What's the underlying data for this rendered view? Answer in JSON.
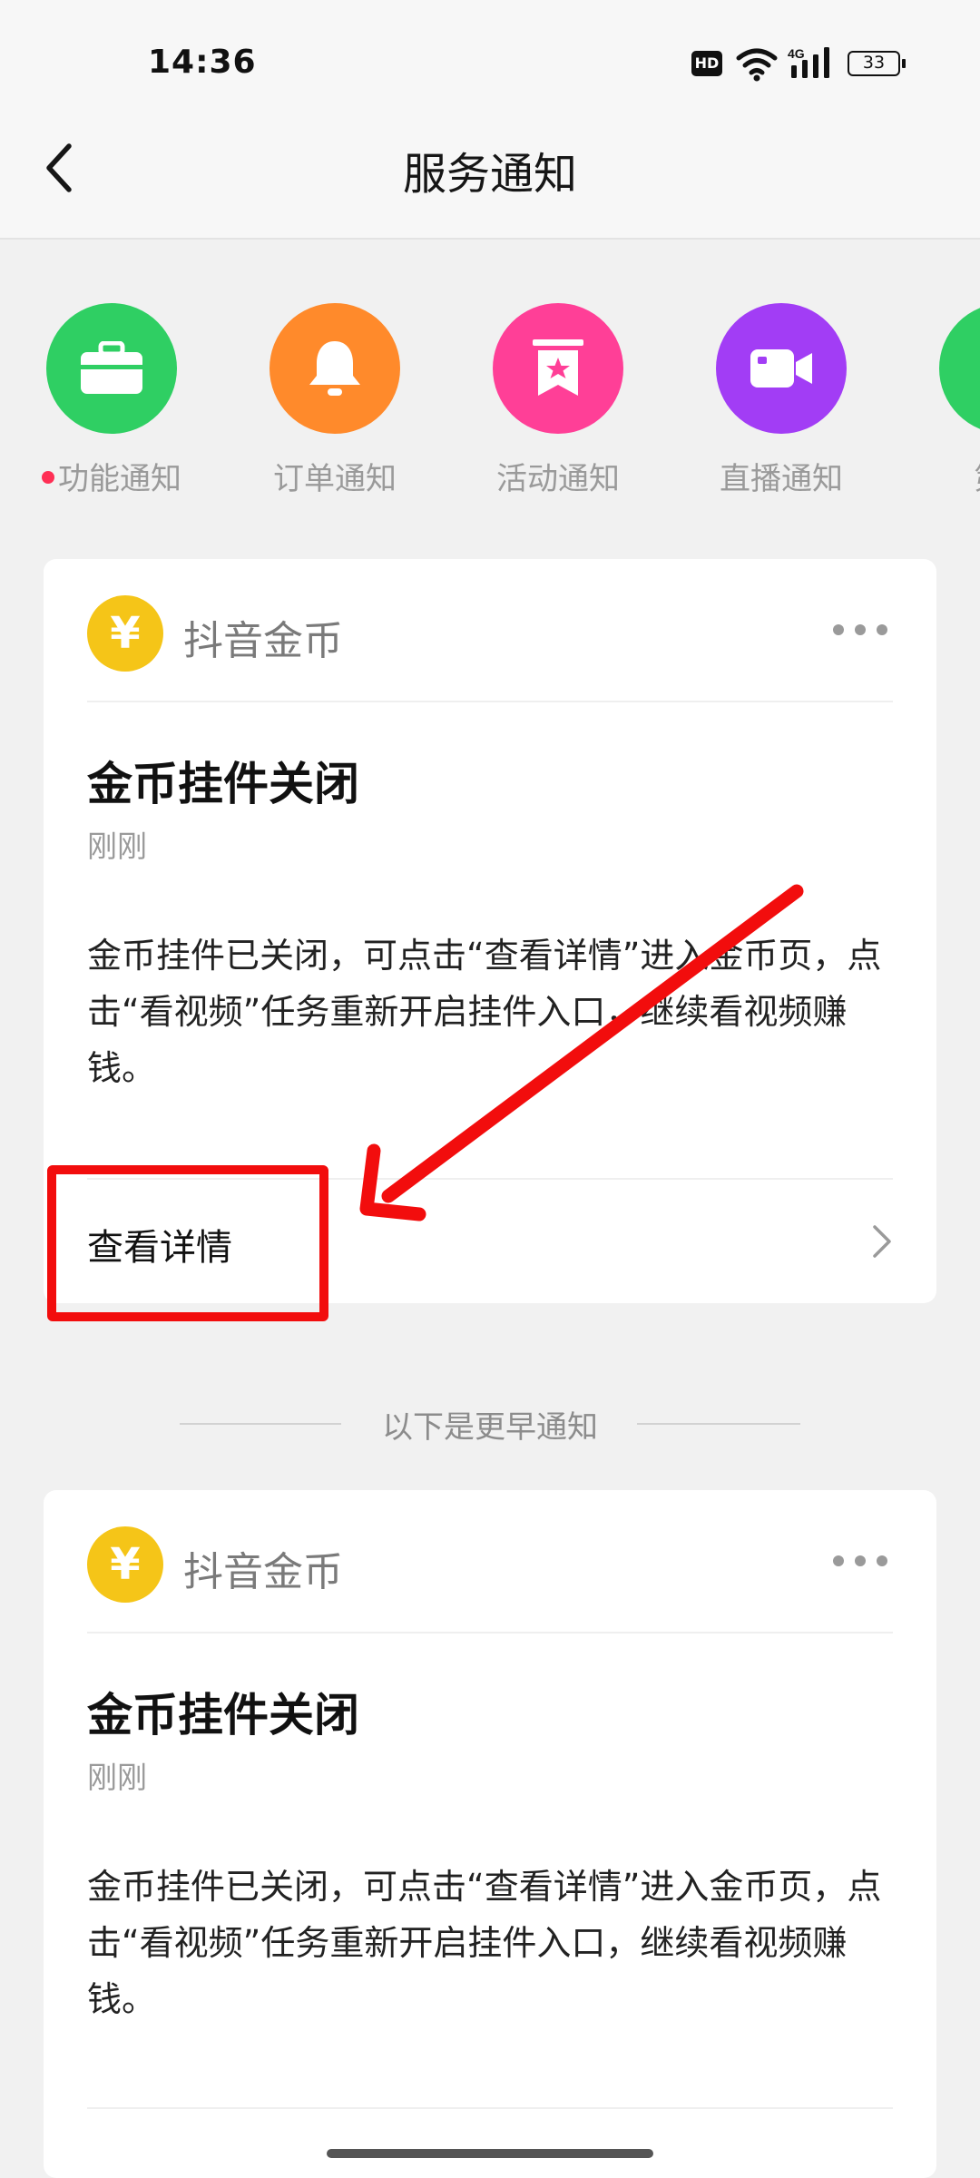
{
  "status_bar": {
    "time": "14:36",
    "network": "4G",
    "battery": "33",
    "hd_label": "HD"
  },
  "header": {
    "title": "服务通知"
  },
  "categories": [
    {
      "label": "功能通知",
      "icon": "briefcase-icon",
      "color": "#2fcf63",
      "has_unread_dot": true
    },
    {
      "label": "订单通知",
      "icon": "bell-icon",
      "color": "#ff8a2b",
      "has_unread_dot": false
    },
    {
      "label": "活动通知",
      "icon": "bookmark-star-icon",
      "color": "#ff3f97",
      "has_unread_dot": false
    },
    {
      "label": "直播通知",
      "icon": "video-camera-icon",
      "color": "#a23df5",
      "has_unread_dot": false
    },
    {
      "label": "第三",
      "icon": "app-icon",
      "color": "#2fcf63",
      "has_unread_dot": false
    }
  ],
  "notifications": [
    {
      "source": "抖音金币",
      "coin_symbol": "¥",
      "title": "金币挂件关闭",
      "time": "刚刚",
      "body": "金币挂件已关闭，可点击“查看详情”进入金币页，点击“看视频”任务重新开启挂件入口，继续看视频赚钱。",
      "action": "查看详情"
    },
    {
      "source": "抖音金币",
      "coin_symbol": "¥",
      "title": "金币挂件关闭",
      "time": "刚刚",
      "body": "金币挂件已关闭，可点击“查看详情”进入金币页，点击“看视频”任务重新开启挂件入口，继续看视频赚钱。"
    }
  ],
  "earlier_label": "以下是更早通知",
  "colors": {
    "accent_red": "#f20d0d",
    "coin_yellow": "#f5c518"
  }
}
